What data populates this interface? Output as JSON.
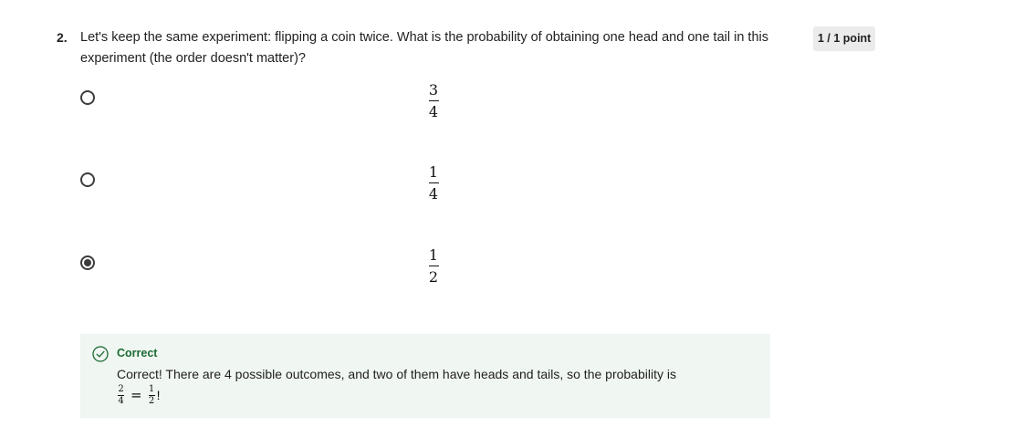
{
  "question": {
    "number": "2.",
    "text": "Let's keep the same experiment: flipping a coin twice. What is the probability of obtaining one head and one tail in this experiment (the order doesn't matter)?",
    "points": "1 / 1 point"
  },
  "options": [
    {
      "numerator": "3",
      "denominator": "4",
      "selected": false
    },
    {
      "numerator": "1",
      "denominator": "4",
      "selected": false
    },
    {
      "numerator": "1",
      "denominator": "2",
      "selected": true
    }
  ],
  "feedback": {
    "status": "Correct",
    "icon": "check-circle-icon",
    "text": "Correct! There are 4 possible outcomes, and two of them have heads and tails, so the probability is",
    "math": {
      "lhs_numerator": "2",
      "lhs_denominator": "4",
      "equals": "=",
      "rhs_numerator": "1",
      "rhs_denominator": "2",
      "suffix": "!"
    },
    "color": "#1c6b34",
    "background": "#f0f6f1"
  }
}
